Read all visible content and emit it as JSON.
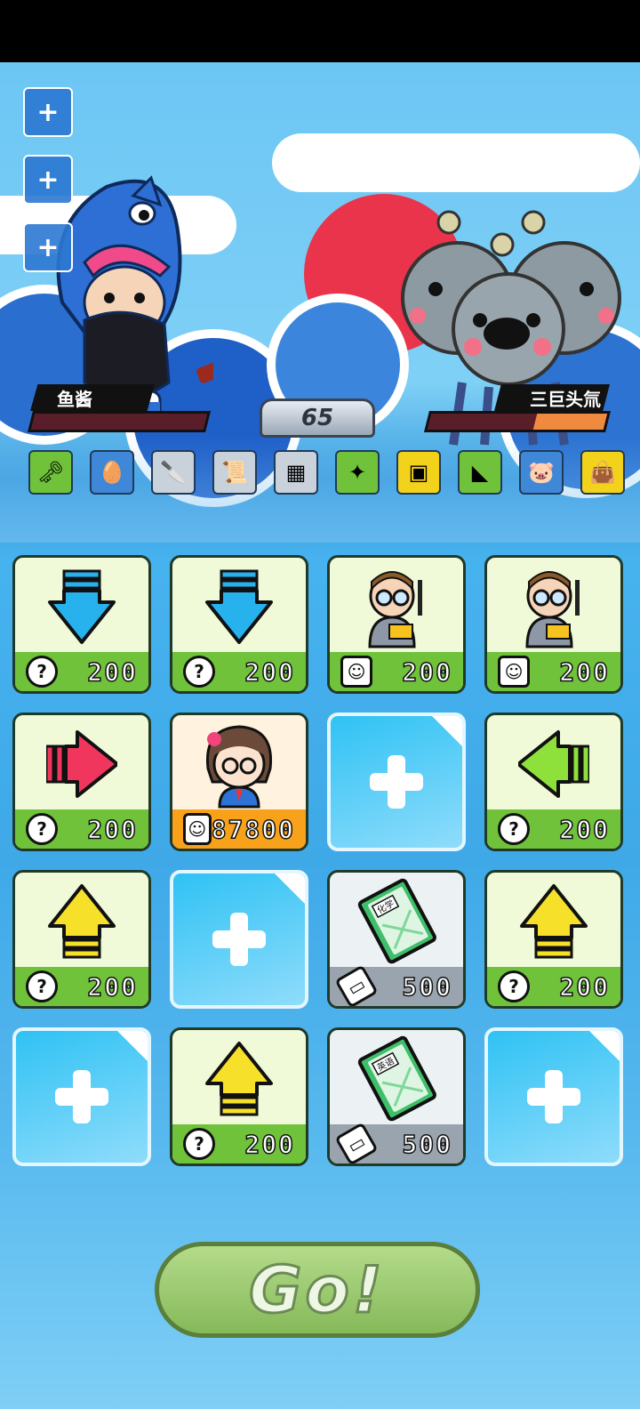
{
  "battle": {
    "player_name": "鱼酱",
    "enemy_name": "三巨头氚",
    "turn_counter": "65",
    "enemy_hp_fraction": 0.4
  },
  "side_buttons": [
    "+",
    "+",
    "+"
  ],
  "items": [
    {
      "icon": "key-icon",
      "color": "#6fc23a"
    },
    {
      "icon": "nest-icon",
      "color": "#3f88d8"
    },
    {
      "icon": "cleaver-icon",
      "color": "#c9d2da"
    },
    {
      "icon": "scroll-icon",
      "color": "#c9d2da"
    },
    {
      "icon": "circuit-board-icon",
      "color": "#c9d2da"
    },
    {
      "icon": "robot-gun-icon",
      "color": "#6fc23a"
    },
    {
      "icon": "ammo-box-icon",
      "color": "#f3d21b"
    },
    {
      "icon": "stapler-icon",
      "color": "#6fc23a"
    },
    {
      "icon": "piggy-bank-icon",
      "color": "#3f88d8"
    },
    {
      "icon": "bag-icon",
      "color": "#f3d21b"
    }
  ],
  "grid": [
    {
      "kind": "card",
      "theme": "green",
      "art": "arrow-down-blue",
      "cost_icon": "?",
      "price": "200"
    },
    {
      "kind": "card",
      "theme": "green",
      "art": "arrow-down-blue",
      "cost_icon": "?",
      "price": "200"
    },
    {
      "kind": "card",
      "theme": "green",
      "art": "teacher",
      "cost_icon": "person",
      "price": "200"
    },
    {
      "kind": "card",
      "theme": "green",
      "art": "teacher",
      "cost_icon": "person",
      "price": "200"
    },
    {
      "kind": "card",
      "theme": "green",
      "art": "arrow-right-red",
      "cost_icon": "?",
      "price": "200"
    },
    {
      "kind": "card",
      "theme": "peach",
      "art": "girl",
      "cost_icon": "person",
      "price": "87800"
    },
    {
      "kind": "slot"
    },
    {
      "kind": "card",
      "theme": "green",
      "art": "arrow-left-lime",
      "cost_icon": "?",
      "price": "200"
    },
    {
      "kind": "card",
      "theme": "green",
      "art": "arrow-up-yellow",
      "cost_icon": "?",
      "price": "200"
    },
    {
      "kind": "slot"
    },
    {
      "kind": "card",
      "theme": "gray",
      "art": "book-chemistry",
      "cost_icon": "eraser",
      "price": "500",
      "book_label": "化学"
    },
    {
      "kind": "card",
      "theme": "green",
      "art": "arrow-up-yellow",
      "cost_icon": "?",
      "price": "200"
    },
    {
      "kind": "slot"
    },
    {
      "kind": "card",
      "theme": "green",
      "art": "arrow-up-yellow",
      "cost_icon": "?",
      "price": "200"
    },
    {
      "kind": "card",
      "theme": "gray",
      "art": "book-english",
      "cost_icon": "eraser",
      "price": "500",
      "book_label": "英语"
    },
    {
      "kind": "slot"
    }
  ],
  "go_button": "Go!",
  "colors": {
    "green_footer": "#6fc23a",
    "peach_footer": "#f7a21a",
    "gray_footer": "#9aa4af"
  }
}
